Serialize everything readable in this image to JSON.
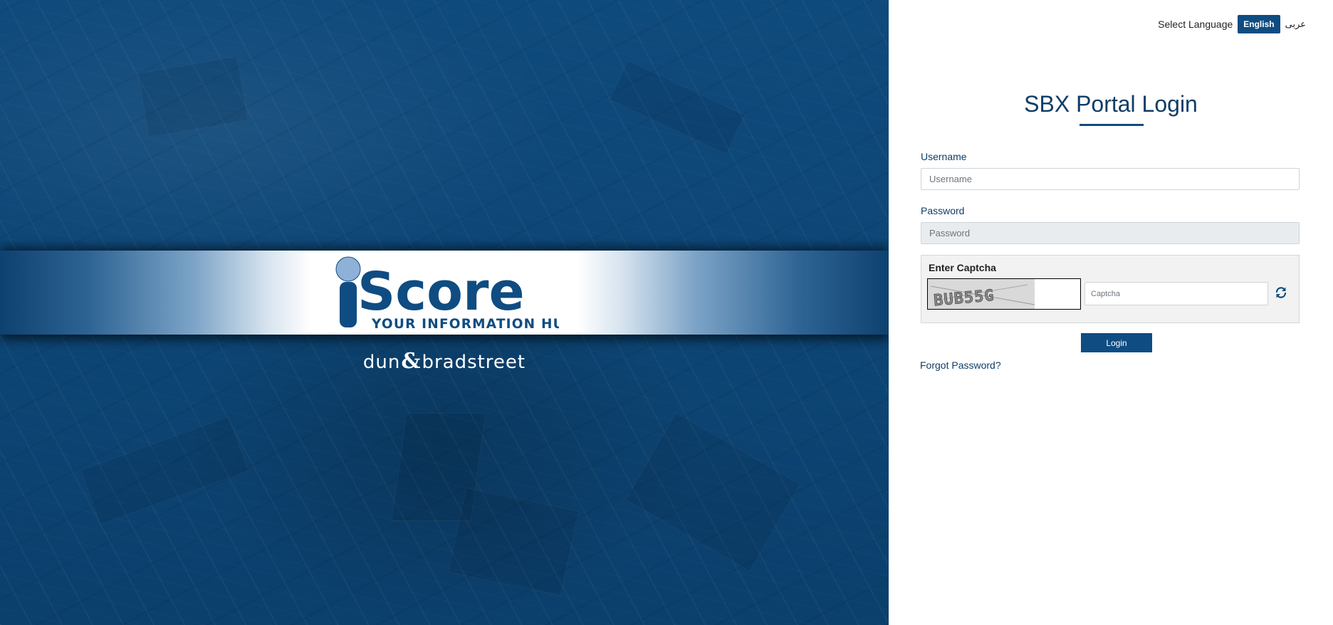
{
  "hero": {
    "logo_wordmark": "Score",
    "logo_tagline": "YOUR INFORMATION HUB",
    "partner_left": "dun",
    "partner_amp": "&",
    "partner_right": "bradstreet"
  },
  "language": {
    "label": "Select Language",
    "options": [
      "English",
      "عربى"
    ],
    "selected": "English"
  },
  "login": {
    "title": "SBX Portal Login",
    "username_label": "Username",
    "username_placeholder": "Username",
    "password_label": "Password",
    "password_placeholder": "Password",
    "captcha_label": "Enter Captcha",
    "captcha_code": "BUB55G",
    "captcha_placeholder": "Captcha",
    "login_button": "Login",
    "forgot_password": "Forgot Password?"
  },
  "colors": {
    "brand_navy": "#0f4c81",
    "hero_blue": "#0d4676",
    "logo_light_blue": "#8fb1d8",
    "title_text": "#0f3d66"
  }
}
